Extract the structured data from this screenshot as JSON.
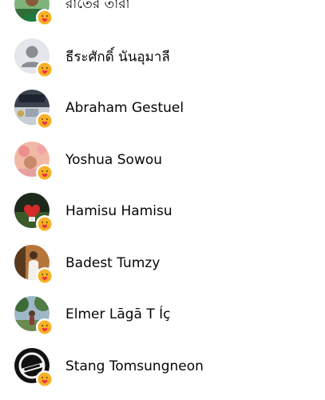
{
  "reactions_list": {
    "reaction_icon": "care-reaction-icon",
    "items": [
      {
        "name": "রাতের তারা",
        "avatar": "photo-man-green"
      },
      {
        "name": "ธีระศักดิ์ นันอุมาลี",
        "avatar": "default-silhouette"
      },
      {
        "name": "Abraham Gestuel",
        "avatar": "photo-dark-interior"
      },
      {
        "name": "Yoshua Sowou",
        "avatar": "photo-pink-flowers"
      },
      {
        "name": "Hamisu Hamisu",
        "avatar": "photo-red-heart"
      },
      {
        "name": "Badest Tumzy",
        "avatar": "photo-person-white"
      },
      {
        "name": "Elmer Lāgā T Íç",
        "avatar": "photo-outdoor-trees"
      },
      {
        "name": "Stang Tomsungneon",
        "avatar": "photo-black-white-logo"
      }
    ]
  },
  "colors": {
    "text": "#050505",
    "care_yellow": "#F7B125",
    "care_heart": "#F0284A"
  }
}
